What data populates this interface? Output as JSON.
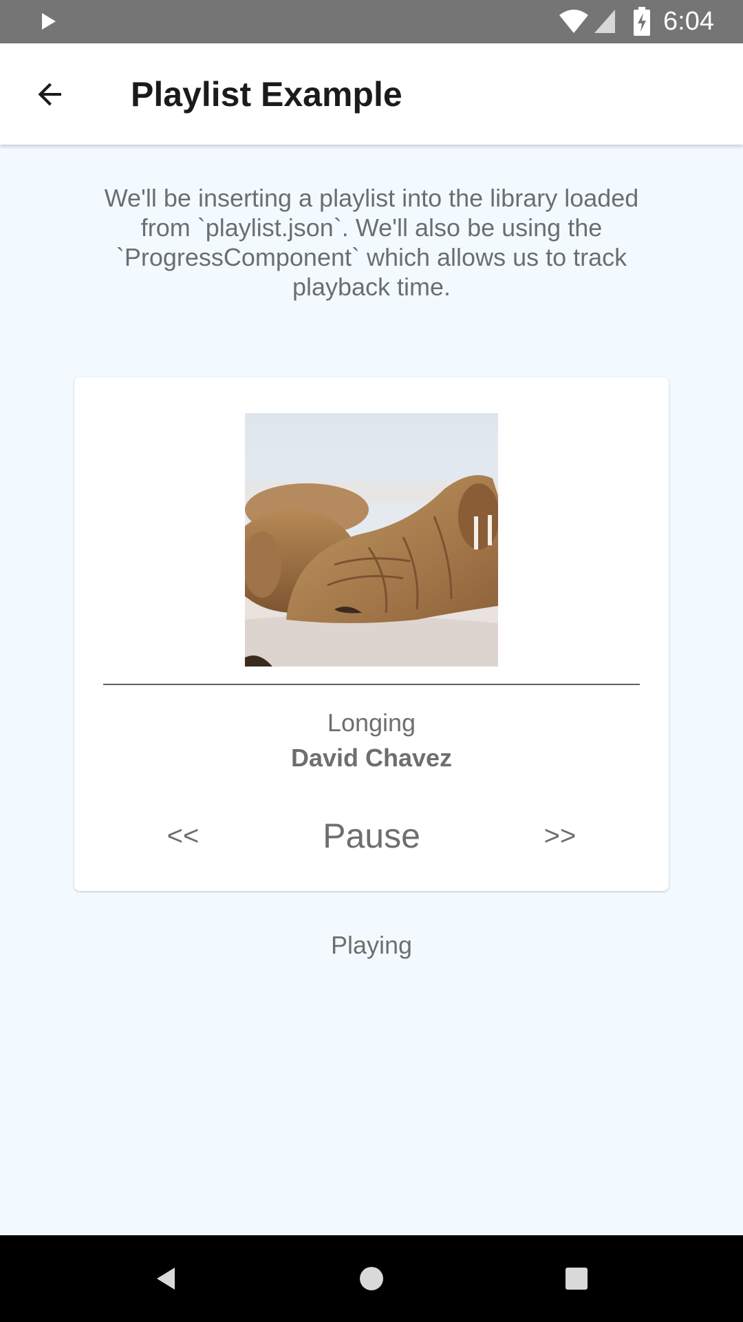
{
  "status_bar": {
    "time": "6:04",
    "icons": [
      "play-icon",
      "wifi-icon",
      "signal-icon",
      "battery-charging-icon"
    ]
  },
  "app_bar": {
    "title": "Playlist Example",
    "back_icon": "arrow-back-icon"
  },
  "description": "We'll be inserting a playlist into the library loaded from `playlist.json`. We'll also be using the `ProgressComponent` which allows us to track playback time.",
  "player": {
    "artwork_icon": "walrus-album-art",
    "progress": 0,
    "track_title": "Longing",
    "track_artist": "David Chavez",
    "controls": {
      "prev_label": "<<",
      "pause_label": "Pause",
      "next_label": ">>"
    }
  },
  "playback_status": "Playing",
  "nav_bar": {
    "icons": [
      "nav-back-icon",
      "nav-home-icon",
      "nav-recents-icon"
    ]
  },
  "colors": {
    "background": "#F3FAFF",
    "status_bar": "#757575",
    "text_muted": "#6E6E6E",
    "title": "#1B1B1B"
  }
}
